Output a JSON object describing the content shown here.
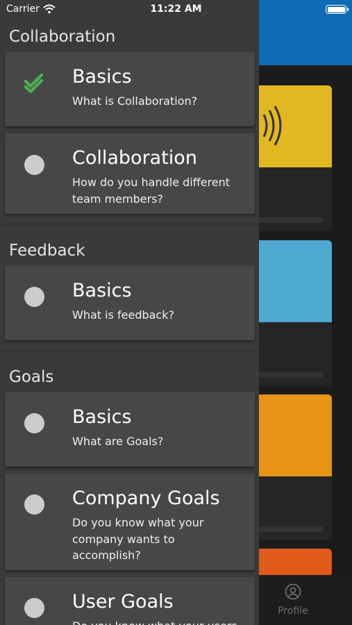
{
  "status_bar": {
    "carrier": "Carrier",
    "time": "11:22 AM"
  },
  "background": {
    "tab_profile_label": "Profile"
  },
  "drawer": {
    "sections": [
      {
        "title": "Collaboration",
        "lessons": [
          {
            "title": "Basics",
            "subtitle": "What is Collaboration?",
            "completed": true
          },
          {
            "title": "Collaboration",
            "subtitle": "How do you handle different team members?",
            "completed": false
          }
        ]
      },
      {
        "title": "Feedback",
        "lessons": [
          {
            "title": "Basics",
            "subtitle": "What is feedback?",
            "completed": false
          }
        ]
      },
      {
        "title": "Goals",
        "lessons": [
          {
            "title": "Basics",
            "subtitle": "What are Goals?",
            "completed": false
          },
          {
            "title": "Company Goals",
            "subtitle": "Do you know what your company wants to accomplish?",
            "completed": false
          },
          {
            "title": "User Goals",
            "subtitle": "Do you know what your users",
            "completed": false
          }
        ]
      }
    ]
  },
  "colors": {
    "check_green": "#4caf50",
    "header_blue": "#0f6bb3"
  }
}
